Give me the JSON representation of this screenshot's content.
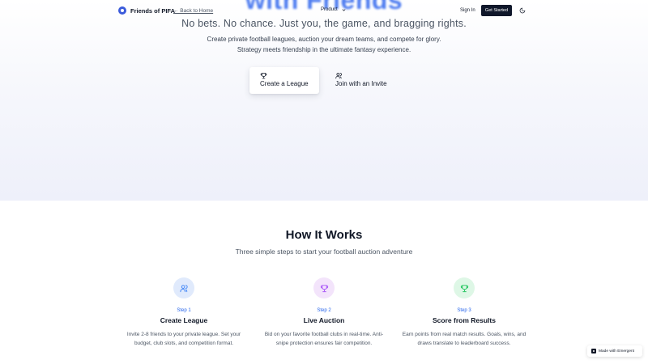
{
  "nav": {
    "brand": "Friends of PIFA",
    "back_link": "← Back to Home",
    "product": "Product",
    "sign_in": "Sign In",
    "get_started": "Get Started",
    "icons": {
      "brand": "brand-logo-icon",
      "product": "chevron-down-icon",
      "theme": "moon-icon"
    }
  },
  "hero": {
    "title_fragment": "with Friends",
    "tagline": "No bets. No chance. Just you, the game, and bragging rights.",
    "description": "Create private football leagues, auction your dream teams, and compete for glory. Strategy meets friendship in the ultimate fantasy experience.",
    "cta_create": {
      "label": "Create a League",
      "icon": "trophy-icon"
    },
    "cta_join": {
      "label": "Join with an Invite",
      "icon": "users-icon"
    }
  },
  "how_it_works": {
    "title": "How It Works",
    "subtitle": "Three simple steps to start your football auction adventure",
    "steps": [
      {
        "number": "Step 1",
        "title": "Create League",
        "description": "Invite 2-8 friends to your private league. Set your budget, club slots, and competition format.",
        "icon": "users-icon",
        "color": "#3b82f6",
        "bg": "#e0eafc"
      },
      {
        "number": "Step 2",
        "title": "Live Auction",
        "description": "Bid on your favorite football clubs in real-time. Anti-snipe protection ensures fair competition.",
        "icon": "trophy-icon",
        "color": "#a855f7",
        "bg": "#f3e4fb"
      },
      {
        "number": "Step 3",
        "title": "Score from Results",
        "description": "Earn points from real match results. Goals, wins, and draws translate to leaderboard success.",
        "icon": "trophy-icon",
        "color": "#22c55e",
        "bg": "#def7e6"
      }
    ]
  },
  "badge": {
    "label": "Made with Emergent",
    "icon": "emergent-logo-icon"
  }
}
